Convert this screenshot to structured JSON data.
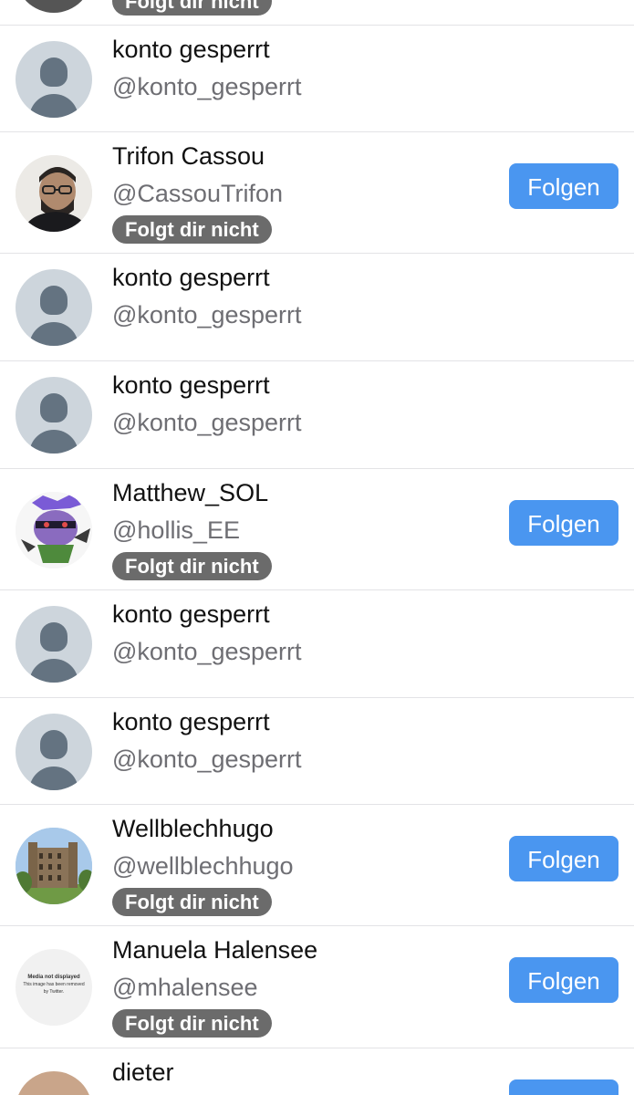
{
  "colors": {
    "follow_button": "#4a96f0",
    "badge_bg": "#6b6b6b",
    "default_avatar_bg": "#cdd5dc",
    "default_avatar_fg": "#647381",
    "separator": "#e3e3e6"
  },
  "top_partial": {
    "badge": "Folgt dir nicht"
  },
  "rows": [
    {
      "name": "konto gesperrt",
      "handle": "@konto_gesperrt",
      "avatar": "default-avatar-icon"
    },
    {
      "name": "Trifon Cassou",
      "handle": "@CassouTrifon",
      "badge": "Folgt dir nicht",
      "button": "Folgen",
      "avatar": "man-with-glasses-photo"
    },
    {
      "name": "konto gesperrt",
      "handle": "@konto_gesperrt",
      "avatar": "default-avatar-icon"
    },
    {
      "name": "konto gesperrt",
      "handle": "@konto_gesperrt",
      "avatar": "default-avatar-icon"
    },
    {
      "name": "Matthew_SOL",
      "handle": "@hollis_EE",
      "badge": "Folgt dir nicht",
      "button": "Folgen",
      "avatar": "purple-cartoon-character"
    },
    {
      "name": "konto gesperrt",
      "handle": "@konto_gesperrt",
      "avatar": "default-avatar-icon"
    },
    {
      "name": "konto gesperrt",
      "handle": "@konto_gesperrt",
      "avatar": "default-avatar-icon"
    },
    {
      "name": "Wellblechhugo",
      "handle": "@wellblechhugo",
      "badge": "Folgt dir nicht",
      "button": "Folgen",
      "avatar": "castle-building-photo"
    },
    {
      "name": "Manuela Halensee",
      "handle": "@mhalensee",
      "badge": "Folgt dir nicht",
      "button": "Folgen",
      "avatar": "media-not-displayed-placeholder",
      "avatar_text": {
        "title": "Media not displayed",
        "line1": "This image has been removed",
        "line2": "by Twitter."
      }
    },
    {
      "name": "dieter"
    }
  ]
}
